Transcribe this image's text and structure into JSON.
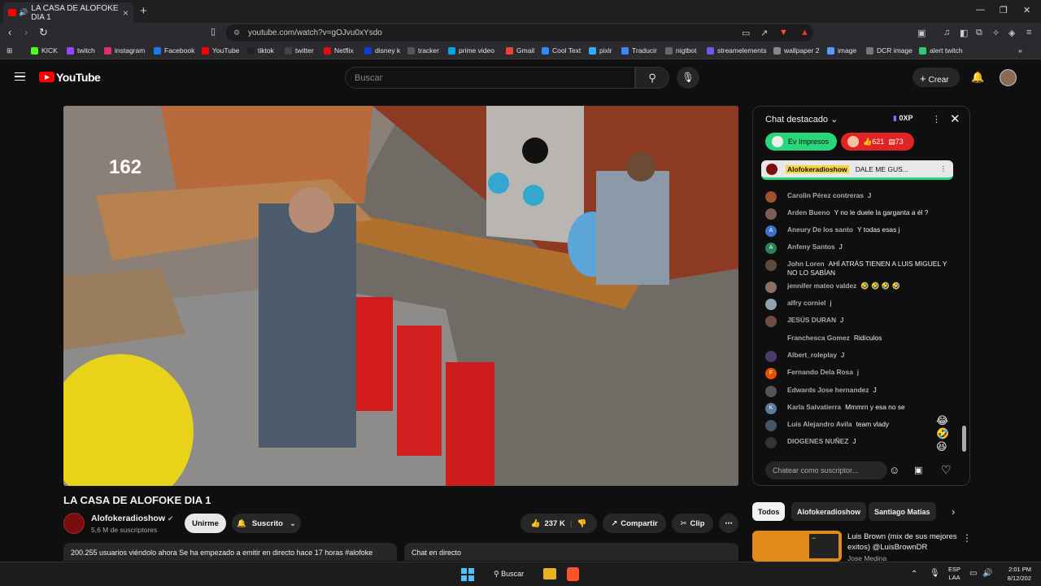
{
  "browser": {
    "tab_title": "LA CASA DE ALOFOKE DIA 1",
    "url": "youtube.com/watch?v=gOJvu0xYsdo",
    "bookmarks": [
      {
        "label": "KICK",
        "color": "#53fc18"
      },
      {
        "label": "twitch",
        "color": "#9146ff"
      },
      {
        "label": "instagram",
        "color": "#e1306c"
      },
      {
        "label": "Facebook",
        "color": "#1877f2"
      },
      {
        "label": "YouTube",
        "color": "#ff0000"
      },
      {
        "label": "tiktok",
        "color": "#222222"
      },
      {
        "label": "twitter",
        "color": "#444444"
      },
      {
        "label": "Netflix",
        "color": "#e50914"
      },
      {
        "label": "disney k",
        "color": "#113ccf"
      },
      {
        "label": "tracker",
        "color": "#555555"
      },
      {
        "label": "prime video",
        "color": "#00a8e1"
      },
      {
        "label": "Gmail",
        "color": "#ea4335"
      },
      {
        "label": "Cool Text",
        "color": "#3388ff"
      },
      {
        "label": "pixlr",
        "color": "#33aaff"
      },
      {
        "label": "Traducir",
        "color": "#4285f4"
      },
      {
        "label": "nigtbot",
        "color": "#666666"
      },
      {
        "label": "streamelements",
        "color": "#6c5ce7"
      },
      {
        "label": "wallpaper 2",
        "color": "#888888"
      },
      {
        "label": "image",
        "color": "#5599ff"
      },
      {
        "label": "DCR image",
        "color": "#777777"
      },
      {
        "label": "alert twitch",
        "color": "#2ecc71"
      }
    ]
  },
  "youtube": {
    "logo_text": "YouTube",
    "search_placeholder": "Buscar",
    "create_label": "Crear"
  },
  "video": {
    "overlay_count": "162",
    "title": "LA CASA DE ALOFOKE DIA 1",
    "channel": "Alofokeradioshow",
    "subscribers": "5,6 M de suscriptores",
    "join_label": "Unirme",
    "subscribed_label": "Suscrito",
    "likes": "237 K",
    "share_label": "Compartir",
    "clip_label": "Clip",
    "viewers_line": "200.255 usuarios viéndolo ahora  Se ha empezado a emitir en directo hace 17 horas  #alofoke",
    "live_chat_label": "Chat en directo"
  },
  "chat": {
    "header": "Chat destacado",
    "xp": "0XP",
    "chip1": "Ev Impresos",
    "chip2_likes": "621",
    "chip2_comments": "73",
    "pinned_author": "Alofokeradioshow",
    "pinned_text": "DALE ME GUS...",
    "messages": [
      {
        "author": "Carolin Pérez contreras",
        "text": "J",
        "color": "#a0522d",
        "initial": ""
      },
      {
        "author": "Arden Bueno",
        "text": "Y no le duele la garganta a él ?",
        "color": "#7b5e57",
        "initial": ""
      },
      {
        "author": "Aneury De los santo",
        "text": "Y todas esas j",
        "color": "#3e6fc9",
        "initial": "A"
      },
      {
        "author": "Anfeny Santos",
        "text": "J",
        "color": "#2e7d5b",
        "initial": "A"
      },
      {
        "author": "John Loren",
        "text": "AHÍ ATRÁS TIENEN A LUIS MIGUEL Y NO LO SABÍAN",
        "color": "#5d4a3a",
        "initial": ""
      },
      {
        "author": "jennifer mateo valdez",
        "text": "🤣 🤣 🤣 🤣",
        "color": "#8d6e63",
        "initial": ""
      },
      {
        "author": "alfry corniel",
        "text": "j",
        "color": "#90a4ae",
        "initial": ""
      },
      {
        "author": "JESÚS DURAN",
        "text": "J",
        "color": "#6d4c41",
        "initial": ""
      },
      {
        "author": "Franchesca Gomez",
        "text": "Ridículos",
        "color": "#0f0f0f",
        "initial": ""
      },
      {
        "author": "Albert_roleplay",
        "text": "J",
        "color": "#4a3b6b",
        "initial": ""
      },
      {
        "author": "Fernando Dela Rosa",
        "text": "j",
        "color": "#e65100",
        "initial": "F"
      },
      {
        "author": "Edwards Jose hernandez",
        "text": "J",
        "color": "#555555",
        "initial": ""
      },
      {
        "author": "Karla Salvatierra",
        "text": "Mmmrn y esa no se",
        "color": "#5c7a99",
        "initial": "K"
      },
      {
        "author": "Luis Alejandro Avila",
        "text": "team vlady",
        "color": "#445566",
        "initial": ""
      },
      {
        "author": "DIOGENES NUÑEZ",
        "text": "J",
        "color": "#333333",
        "initial": ""
      }
    ],
    "input_placeholder": "Chatear como suscriptor..."
  },
  "filters": [
    "Todos",
    "Alofokeradioshow",
    "Santiago Matías"
  ],
  "recommended": {
    "title": "Luis Brown (mix de sus mejores exitos) @LuisBrownDR",
    "channel": "Jose Medina"
  },
  "taskbar": {
    "search_label": "Buscar",
    "lang1": "ESP",
    "lang2": "LAA",
    "time": "2:01 PM",
    "date": "8/12/202"
  }
}
